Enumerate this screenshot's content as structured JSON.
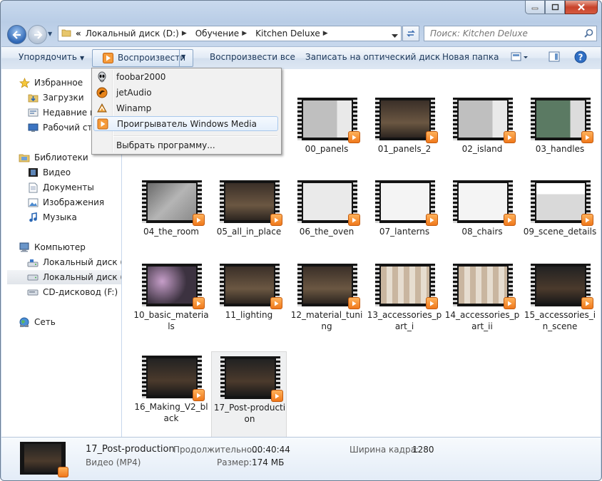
{
  "window": {
    "caption_buttons": [
      "minimize",
      "maximize",
      "close"
    ]
  },
  "address_bar": {
    "overflow": "«",
    "segments": [
      "Локальный диск (D:)",
      "Обучение",
      "Kitchen Deluxe"
    ]
  },
  "search": {
    "placeholder": "Поиск: Kitchen Deluxe"
  },
  "toolbar": {
    "organize": "Упорядочить",
    "play": "Воспроизвести",
    "play_all": "Воспроизвести все",
    "burn": "Записать на оптический диск",
    "new_folder": "Новая папка"
  },
  "play_menu": {
    "items": [
      {
        "label": "foobar2000",
        "icon": "foobar-icon"
      },
      {
        "label": "jetAudio",
        "icon": "jetaudio-icon"
      },
      {
        "label": "Winamp",
        "icon": "winamp-icon"
      },
      {
        "label": "Проигрыватель Windows Media",
        "icon": "wmp-icon"
      }
    ],
    "choose": "Выбрать программу..."
  },
  "sidebar": {
    "favorites": {
      "label": "Избранное",
      "items": [
        "Загрузки",
        "Недавние места",
        "Рабочий стол"
      ]
    },
    "libraries": {
      "label": "Библиотеки",
      "items": [
        "Видео",
        "Документы",
        "Изображения",
        "Музыка"
      ]
    },
    "computer": {
      "label": "Компьютер",
      "items": [
        "Локальный диск (C:)",
        "Локальный диск (D:)",
        "CD-дисковод (F:)"
      ]
    },
    "network": {
      "label": "Сеть"
    }
  },
  "files": [
    {
      "name": "00_panels"
    },
    {
      "name": "01_panels_2"
    },
    {
      "name": "02_island"
    },
    {
      "name": "03_handles"
    },
    {
      "name": "04_the_room"
    },
    {
      "name": "05_all_in_place"
    },
    {
      "name": "06_the_oven"
    },
    {
      "name": "07_lanterns"
    },
    {
      "name": "08_chairs"
    },
    {
      "name": "09_scene_details"
    },
    {
      "name": "10_basic_materials"
    },
    {
      "name": "11_lighting"
    },
    {
      "name": "12_material_tuning"
    },
    {
      "name": "13_accessories_part_i"
    },
    {
      "name": "14_accessories_part_ii"
    },
    {
      "name": "15_accessories_in_scene"
    },
    {
      "name": "16_Making_V2_black"
    },
    {
      "name": "17_Post-production"
    }
  ],
  "selected_file": "17_Post-production",
  "details": {
    "name": "17_Post-production",
    "type": "Видео (MP4)",
    "duration_label": "Продолжительно...",
    "duration": "00:40:44",
    "size_label": "Размер:",
    "size": "174 МБ",
    "width_label": "Ширина кадра:",
    "width": "1280"
  }
}
